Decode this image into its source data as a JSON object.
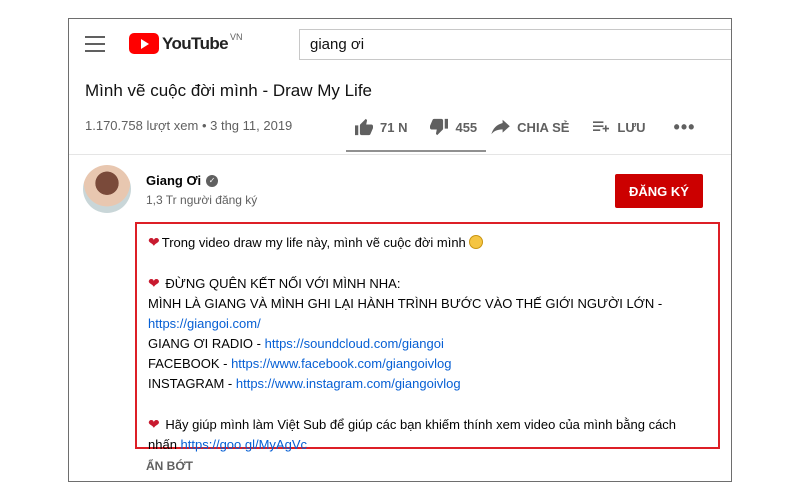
{
  "masthead": {
    "logo_text": "YouTube",
    "region": "VN",
    "search_value": "giang ơi",
    "icons": [
      "menu-icon",
      "youtube-logo"
    ]
  },
  "video": {
    "title": "Mình vẽ cuộc đời mình - Draw My Life",
    "views_date": "1.170.758 lượt xem • 3 thg 11, 2019",
    "actions": {
      "like": "71 N",
      "dislike": "455",
      "share": "CHIA SẺ",
      "save": "LƯU",
      "more": "•••"
    }
  },
  "channel": {
    "name": "Giang Ơi",
    "subscribers": "1,3 Tr người đăng ký",
    "subscribe_label": "ĐĂNG KÝ",
    "subscribe_color": "#cc0000"
  },
  "description": {
    "line1": "Trong video draw my life này, mình vẽ cuộc đời mình",
    "line2": "ĐỪNG QUÊN KẾT NỐI VỚI MÌNH NHA:",
    "line3": "MÌNH LÀ GIANG VÀ MÌNH GHI LẠI HÀNH TRÌNH BƯỚC VÀO THẾ GIỚI NGƯỜI LỚN -",
    "link_site": "https://giangoi.com/",
    "radio_label": "GIANG ƠI RADIO - ",
    "radio_link": "https://soundcloud.com/giangoi",
    "facebook_label": "FACEBOOK - ",
    "facebook_link": "https://www.facebook.com/giangoivlog",
    "instagram_label": "INSTAGRAM - ",
    "instagram_link": "https://www.instagram.com/giangoivlog",
    "viet_sub_text": "Hãy giúp mình làm Việt Sub để giúp các bạn khiếm thính xem video của mình bằng cách",
    "viet_sub_prefix": "nhấn ",
    "viet_sub_link": "https://goo.gl/MyAgVc",
    "highlight_color": "#dd1f26"
  },
  "show_less": "ẨN BỚT"
}
